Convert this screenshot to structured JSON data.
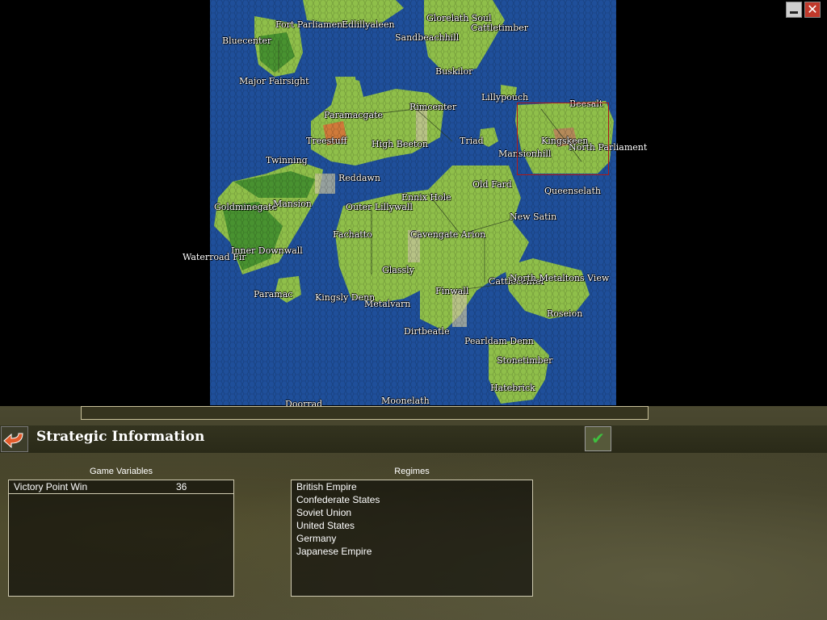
{
  "window": {
    "minimize_icon": "minimize-icon",
    "close_icon": "close-icon"
  },
  "map": {
    "cities": [
      {
        "id": "glorelath-soul",
        "name": "Glorelath Soul"
      },
      {
        "id": "fort-parliament",
        "name": "Fort Parliament"
      },
      {
        "id": "edlillyaleen",
        "name": "Edlillyaleen"
      },
      {
        "id": "cattletimber",
        "name": "Cattletimber"
      },
      {
        "id": "bluecenter",
        "name": "Bluecenter"
      },
      {
        "id": "sandbeachhill",
        "name": "Sandbeachhill"
      },
      {
        "id": "buskilor",
        "name": "Buskilor"
      },
      {
        "id": "major-fairsight",
        "name": "Major Fairsight"
      },
      {
        "id": "lillypouch",
        "name": "Lillypouch"
      },
      {
        "id": "beesalt",
        "name": "Beesalt"
      },
      {
        "id": "paramacgate",
        "name": "Paramacgate"
      },
      {
        "id": "rimcenter",
        "name": "Rimcenter"
      },
      {
        "id": "treestuff",
        "name": "Treestuff"
      },
      {
        "id": "high-beeton",
        "name": "High Beeton"
      },
      {
        "id": "triad",
        "name": "Triad"
      },
      {
        "id": "kingskeen",
        "name": "Kingskeen"
      },
      {
        "id": "north-parliament",
        "name": "North Parliament"
      },
      {
        "id": "mansionhill",
        "name": "Mansionhill"
      },
      {
        "id": "twinning",
        "name": "Twinning"
      },
      {
        "id": "reddawn",
        "name": "Reddawn"
      },
      {
        "id": "old-fard",
        "name": "Old Fard"
      },
      {
        "id": "queenselath",
        "name": "Queenselath"
      },
      {
        "id": "ennix-hole",
        "name": "Ennix Hole"
      },
      {
        "id": "goldminegate",
        "name": "Goldminegate"
      },
      {
        "id": "mansion",
        "name": "Mansion"
      },
      {
        "id": "outer-lillywall",
        "name": "Outer Lillywall"
      },
      {
        "id": "new-satin",
        "name": "New Satin"
      },
      {
        "id": "fachatto",
        "name": "Fachatto"
      },
      {
        "id": "cavengate-arion",
        "name": "Cavengate Arion"
      },
      {
        "id": "inner-downwall",
        "name": "Inner Downwall"
      },
      {
        "id": "waterroad-fir",
        "name": "Waterroad Fir"
      },
      {
        "id": "glassly",
        "name": "Glassly"
      },
      {
        "id": "cattlecenter",
        "name": "Cattlecenter"
      },
      {
        "id": "north-metaltons-view",
        "name": "North Metaltons View"
      },
      {
        "id": "paramac",
        "name": "Paramac"
      },
      {
        "id": "finwall",
        "name": "Finwall"
      },
      {
        "id": "kingsly-denn",
        "name": "Kingsly Denn"
      },
      {
        "id": "metalvarn",
        "name": "Metalvarn"
      },
      {
        "id": "roseion",
        "name": "Roseion"
      },
      {
        "id": "dirtbeatle",
        "name": "Dirtbeatle"
      },
      {
        "id": "pearldam-denn",
        "name": "Pearldam Denn"
      },
      {
        "id": "stonetimber",
        "name": "Stonetimber"
      },
      {
        "id": "hatebrick",
        "name": "Hatebrick"
      },
      {
        "id": "doorrad",
        "name": "Doorrad"
      },
      {
        "id": "moonelath",
        "name": "Moonelath"
      }
    ]
  },
  "header": {
    "title": "Strategic Information",
    "back_icon": "arrow-back-icon",
    "ok_icon": "checkmark-icon"
  },
  "game_variables": {
    "caption": "Game Variables",
    "rows": [
      {
        "name": "Victory Point Win",
        "value": "36"
      }
    ]
  },
  "regimes": {
    "caption": "Regimes",
    "items": [
      "British Empire",
      "Confederate States",
      "Soviet Union",
      "United States",
      "Germany",
      "Japanese Empire"
    ]
  },
  "colors": {
    "sea": "#1f4f9a",
    "land": "#8fbf4a",
    "forest": "#3c8a2c",
    "panel_border": "#cfcab0",
    "ok_green": "#3fbf3f"
  }
}
